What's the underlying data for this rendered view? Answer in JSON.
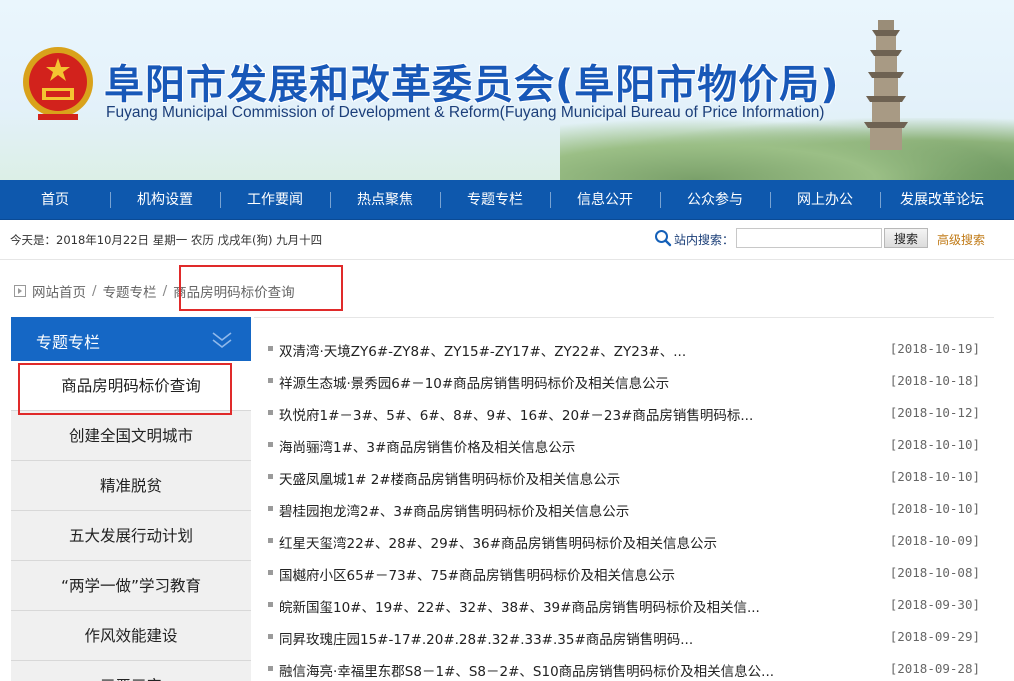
{
  "header": {
    "title_cn": "阜阳市发展和改革委员会(阜阳市物价局)",
    "title_en": "Fuyang Municipal Commission of Development & Reform(Fuyang Municipal Bureau of Price Information)"
  },
  "nav": {
    "items": [
      {
        "label": "首页"
      },
      {
        "label": "机构设置"
      },
      {
        "label": "工作要闻"
      },
      {
        "label": "热点聚焦"
      },
      {
        "label": "专题专栏"
      },
      {
        "label": "信息公开"
      },
      {
        "label": "公众参与"
      },
      {
        "label": "网上办公"
      },
      {
        "label": "发展改革论坛"
      }
    ]
  },
  "infobar": {
    "date_text": "今天是：2018年10月22日 星期一 农历 戊戌年(狗) 九月十四",
    "search_label": "站内搜索：",
    "search_value": "",
    "search_button": "搜索",
    "advanced_search": "高级搜索"
  },
  "breadcrumb": {
    "home": "网站首页",
    "section": "专题专栏",
    "current": "商品房明码标价查询",
    "separator": "/"
  },
  "sidebar": {
    "title": "专题专栏",
    "items": [
      {
        "label": "商品房明码标价查询"
      },
      {
        "label": "创建全国文明城市"
      },
      {
        "label": "精准脱贫"
      },
      {
        "label": "五大发展行动计划"
      },
      {
        "label": "“两学一做”学习教育"
      },
      {
        "label": "作风效能建设"
      },
      {
        "label": "三严三实"
      }
    ]
  },
  "list": {
    "items": [
      {
        "title": "双清湾·天境ZY6#-ZY8#、ZY15#-ZY17#、ZY22#、ZY23#、...",
        "date": "[2018-10-19]"
      },
      {
        "title": "祥源生态城·景秀园6#－10#商品房销售明码标价及相关信息公示",
        "date": "[2018-10-18]"
      },
      {
        "title": "玖悦府1#－3#、5#、6#、8#、9#、16#、20#－23#商品房销售明码标...",
        "date": "[2018-10-12]"
      },
      {
        "title": "海尚骊湾1#、3#商品房销售价格及相关信息公示",
        "date": "[2018-10-10]"
      },
      {
        "title": "天盛凤凰城1# 2#楼商品房销售明码标价及相关信息公示",
        "date": "[2018-10-10]"
      },
      {
        "title": "碧桂园抱龙湾2#、3#商品房销售明码标价及相关信息公示",
        "date": "[2018-10-10]"
      },
      {
        "title": "红星天玺湾22#、28#、29#、36#商品房销售明码标价及相关信息公示",
        "date": "[2018-10-09]"
      },
      {
        "title": "国樾府小区65#－73#、75#商品房销售明码标价及相关信息公示",
        "date": "[2018-10-08]"
      },
      {
        "title": "皖新国玺10#、19#、22#、32#、38#、39#商品房销售明码标价及相关信...",
        "date": "[2018-09-30]"
      },
      {
        "title": "同昇玫瑰庄园15#-17#.20#.28#.32#.33#.35#商品房销售明码...",
        "date": "[2018-09-29]"
      },
      {
        "title": "融信海亮·幸福里东郡S8－1#、S8－2#、S10商品房销售明码标价及相关信息公...",
        "date": "[2018-09-28]"
      }
    ]
  },
  "colors": {
    "nav_bg": "#0e58ad",
    "sidebar_head": "#1567c5",
    "title_blue": "#1858b8",
    "highlight_red": "#e02a2a",
    "adv_search_orange": "#c07a16"
  },
  "icons": {
    "emblem": "national-emblem-icon",
    "search": "search-icon",
    "home": "home-icon",
    "chevron": "chevron-down-double-icon"
  }
}
